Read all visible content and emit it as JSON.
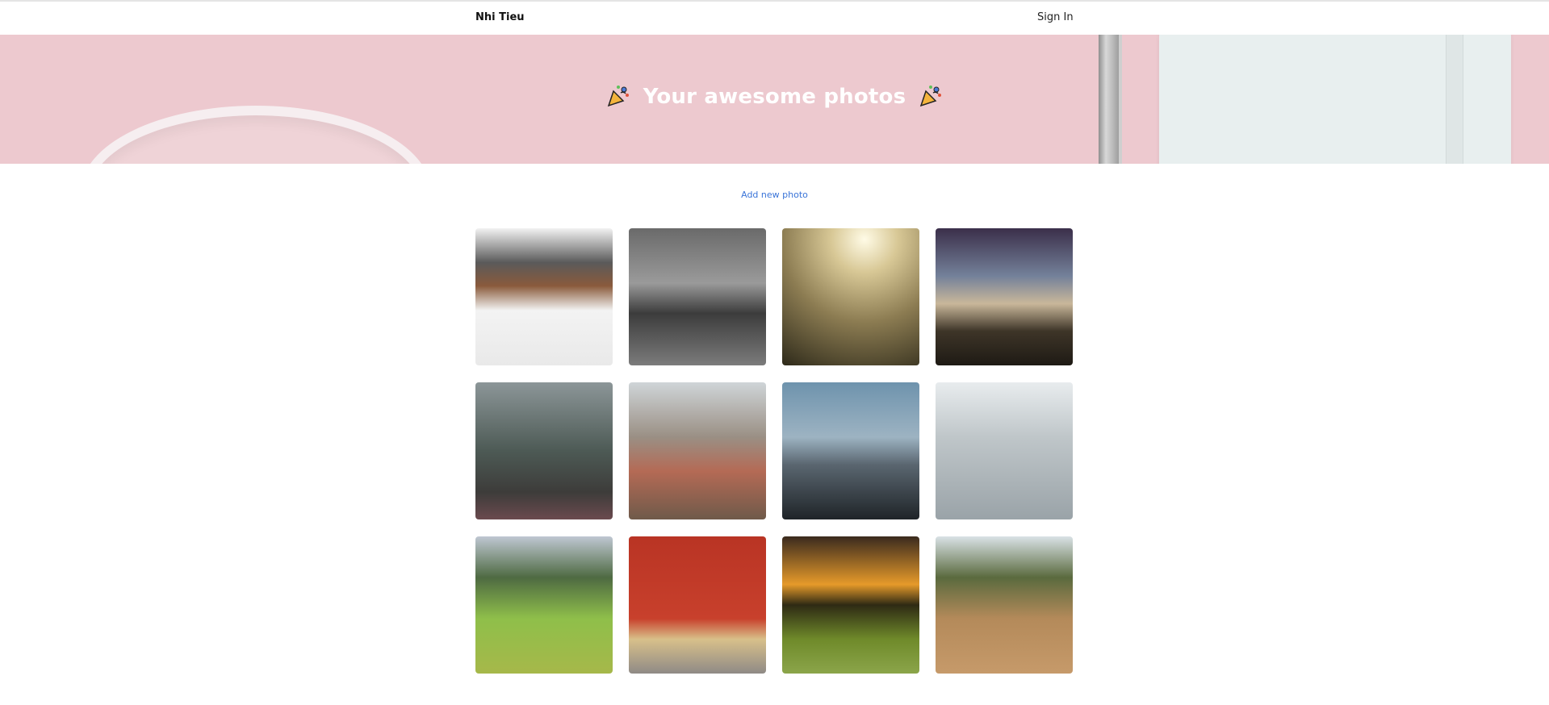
{
  "nav": {
    "brand": "Nhi Tieu",
    "sign_in": "Sign In"
  },
  "hero": {
    "title": "Your awesome photos",
    "left_icon": "party-popper-icon",
    "right_icon": "party-popper-icon"
  },
  "actions": {
    "add_photo": "Add new photo",
    "link_color": "#3a74d8"
  },
  "gallery": {
    "photos": [
      {
        "subject": "desk workspace"
      },
      {
        "subject": "city bridge at night"
      },
      {
        "subject": "foggy tree"
      },
      {
        "subject": "rocky summit"
      },
      {
        "subject": "misty forest path"
      },
      {
        "subject": "city skyline"
      },
      {
        "subject": "plane wreck on beach"
      },
      {
        "subject": "snowy forest"
      },
      {
        "subject": "green mountain valley"
      },
      {
        "subject": "red wall with bicycle"
      },
      {
        "subject": "sunset field"
      },
      {
        "subject": "dry grass field"
      }
    ]
  },
  "colors": {
    "hero_bg": "#edc9cf",
    "text": "#111111",
    "title": "#ffffff"
  }
}
